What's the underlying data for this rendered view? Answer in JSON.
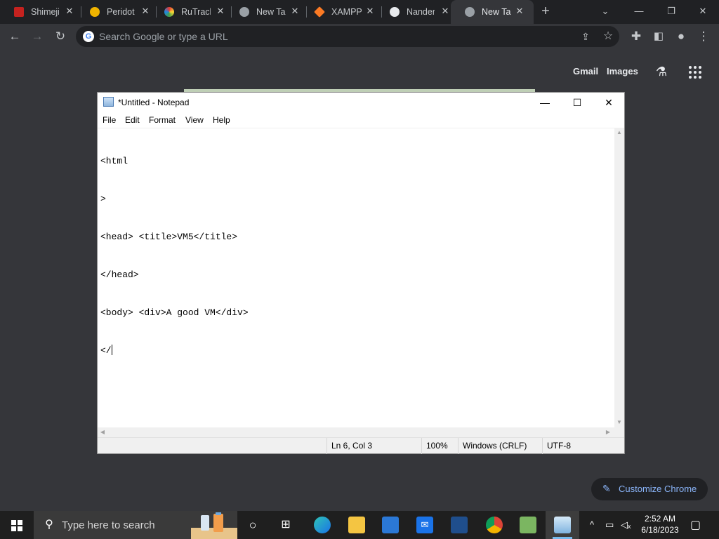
{
  "browser": {
    "tabs": [
      {
        "title": "Shimeji",
        "favicon_color": "#c5221f"
      },
      {
        "title": "Peridot",
        "favicon_color": "#f0b400"
      },
      {
        "title": "RuTrack",
        "favicon_color": "#5b8bd4"
      },
      {
        "title": "New Tal",
        "favicon_color": "#9aa0a6"
      },
      {
        "title": "XAMPP",
        "favicon_color": "#fb7a24"
      },
      {
        "title": "Nander",
        "favicon_color": "#e8eaed"
      },
      {
        "title": "New Tal",
        "favicon_color": "#9aa0a6"
      }
    ],
    "omnibox_placeholder": "Search Google or type a URL",
    "ntp": {
      "gmail_label": "Gmail",
      "images_label": "Images",
      "customize_label": "Customize Chrome"
    }
  },
  "notepad": {
    "title": "*Untitled - Notepad",
    "menu": [
      "File",
      "Edit",
      "Format",
      "View",
      "Help"
    ],
    "lines": [
      "<html",
      ">",
      "<head> <title>VM5</title>",
      "</head>",
      "<body> <div>A good VM</div>",
      "</"
    ],
    "status": {
      "position": "Ln 6, Col 3",
      "zoom": "100%",
      "line_ending": "Windows (CRLF)",
      "encoding": "UTF-8"
    }
  },
  "taskbar": {
    "search_placeholder": "Type here to search",
    "time": "2:52 AM",
    "date": "6/18/2023"
  },
  "colors": {
    "browser_frame": "#202124",
    "browser_toolbar": "#35363a",
    "accent_blue": "#8ab4f8",
    "taskbar": "#1f1f1f"
  }
}
